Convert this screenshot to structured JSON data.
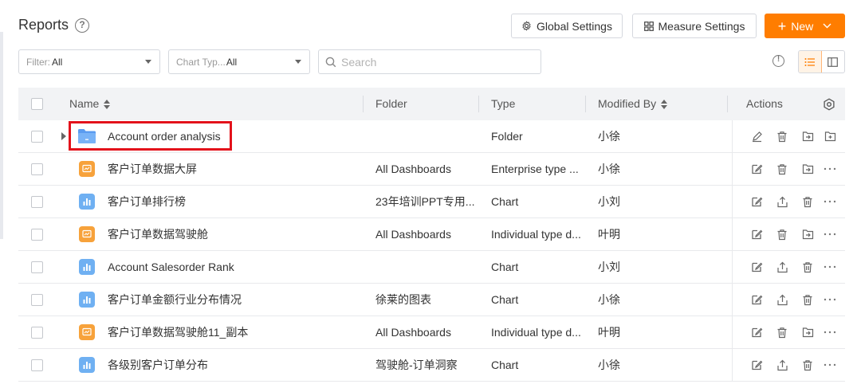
{
  "header": {
    "title": "Reports",
    "help_icon": "question-circle-icon",
    "global_settings_label": "Global Settings",
    "measure_settings_label": "Measure Settings",
    "new_label": "New",
    "accent_color": "#ff7d00"
  },
  "toolbar": {
    "filter_label": "Filter:",
    "filter_value": "All",
    "chart_type_label": "Chart Typ...",
    "chart_type_value": "All",
    "search_placeholder": "Search",
    "search_value": "",
    "view_modes": [
      "list",
      "card"
    ],
    "active_view": "list"
  },
  "table": {
    "columns": {
      "name": "Name",
      "folder": "Folder",
      "type": "Type",
      "modified_by": "Modified By",
      "actions": "Actions"
    },
    "rows": [
      {
        "name": "Account order analysis",
        "folder": "",
        "type": "Folder",
        "modified_by": "小徐",
        "icon": "folder-icon",
        "highlighted": true
      },
      {
        "name": "客户订单数据大屏",
        "folder": "All Dashboards",
        "type": "Enterprise type ...",
        "modified_by": "小徐",
        "icon": "dashboard-icon"
      },
      {
        "name": "客户订单排行榜",
        "folder": "23年培训PPT专用...",
        "type": "Chart",
        "modified_by": "小刘",
        "icon": "chart-icon"
      },
      {
        "name": "客户订单数据驾驶舱",
        "folder": "All Dashboards",
        "type": "Individual type d...",
        "modified_by": "叶明",
        "icon": "dashboard-icon"
      },
      {
        "name": "Account Salesorder Rank",
        "folder": "",
        "type": "Chart",
        "modified_by": "小刘",
        "icon": "chart-icon"
      },
      {
        "name": "客户订单金额行业分布情况",
        "folder": "徐莱的图表",
        "type": "Chart",
        "modified_by": "小徐",
        "icon": "chart-icon"
      },
      {
        "name": "客户订单数据驾驶舱11_副本",
        "folder": "All Dashboards",
        "type": "Individual type d...",
        "modified_by": "叶明",
        "icon": "dashboard-icon"
      },
      {
        "name": "各级别客户订单分布",
        "folder": "驾驶舱-订单洞察",
        "type": "Chart",
        "modified_by": "小徐",
        "icon": "chart-icon"
      }
    ]
  }
}
